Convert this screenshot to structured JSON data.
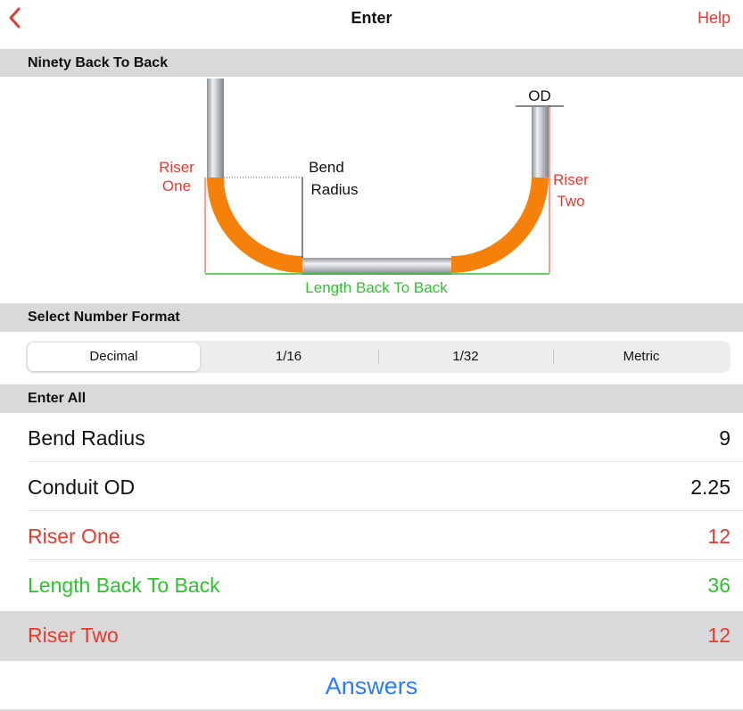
{
  "nav": {
    "title": "Enter",
    "help": "Help"
  },
  "sections": {
    "diagram": "Ninety Back To Back",
    "format": "Select Number Format",
    "enter": "Enter All"
  },
  "diagram": {
    "riser_one": [
      "Riser",
      "One"
    ],
    "riser_two": [
      "Riser",
      "Two"
    ],
    "bend_radius": [
      "Bend",
      "Radius"
    ],
    "od": "OD",
    "length": "Length Back To Back"
  },
  "format": {
    "options": [
      "Decimal",
      "1/16",
      "1/32",
      "Metric"
    ],
    "selected": "Decimal"
  },
  "fields": [
    {
      "label": "Bend Radius",
      "value": "9",
      "color": "#111111"
    },
    {
      "label": "Conduit OD",
      "value": "2.25",
      "color": "#111111"
    },
    {
      "label": "Riser One",
      "value": "12",
      "color": "#e63b2e"
    },
    {
      "label": "Length Back To Back",
      "value": "36",
      "color": "#2fc12f"
    },
    {
      "label": "Riser Two",
      "value": "12",
      "color": "#e63b2e",
      "selected": true
    }
  ],
  "answers": "Answers",
  "colors": {
    "accent": "#e63b2e",
    "link": "#2a7df6",
    "pipe_bend": "#f5800a",
    "green": "#2fc12f"
  }
}
